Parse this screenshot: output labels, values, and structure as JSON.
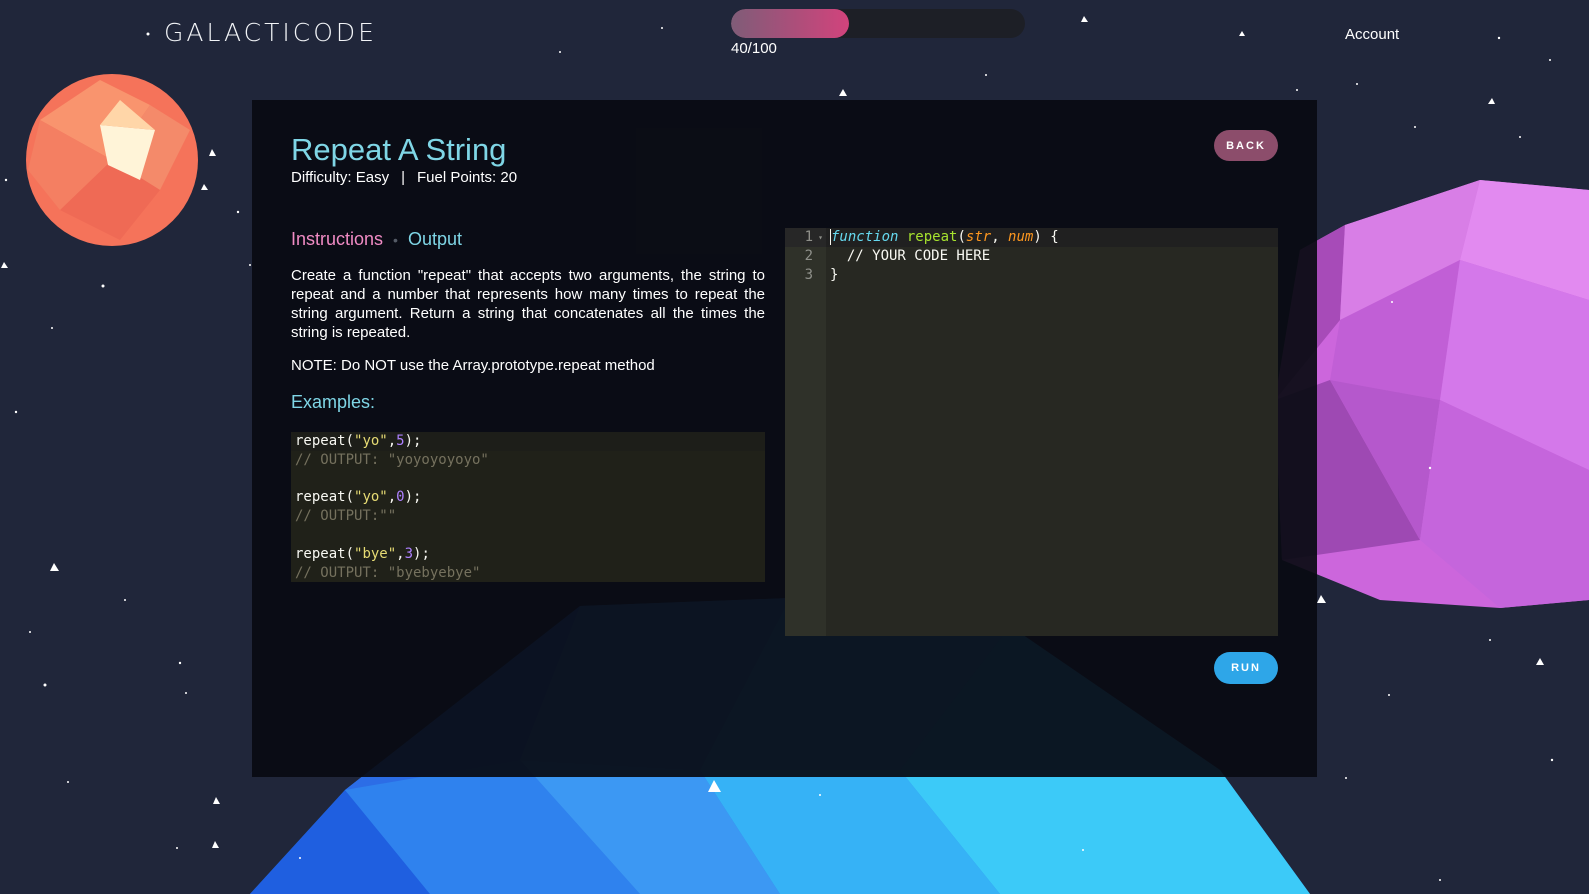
{
  "header": {
    "logo": "GALACTICODE",
    "progress": {
      "current": 40,
      "max": 100,
      "label": "40/100"
    },
    "account_label": "Account"
  },
  "challenge": {
    "title": "Repeat A String",
    "difficulty": "Difficulty: Easy",
    "separator": "|",
    "fuel_points": "Fuel Points: 20",
    "back_label": "BACK",
    "tabs": {
      "instructions": "Instructions",
      "output": "Output"
    },
    "instructions_text": "Create a function \"repeat\" that accepts two arguments, the string to repeat and a number that represents how many times to repeat the string argument. Return a string that concatenates all the times the string is repeated.",
    "note": "NOTE: Do NOT use the Array.prototype.repeat method",
    "examples_heading": "Examples:",
    "examples": [
      {
        "call_pre": "repeat(",
        "arg_str": "\"yo\"",
        "comma": ",",
        "arg_num": "5",
        "call_post": ");",
        "output": "// OUTPUT: \"yoyoyoyoyo\""
      },
      {
        "call_pre": "repeat(",
        "arg_str": "\"yo\"",
        "comma": ",",
        "arg_num": "0",
        "call_post": ");",
        "output": "// OUTPUT:\"\""
      },
      {
        "call_pre": "repeat(",
        "arg_str": "\"bye\"",
        "comma": ",",
        "arg_num": "3",
        "call_post": ");",
        "output": "// OUTPUT: \"byebyebye\""
      }
    ],
    "run_label": "RUN"
  },
  "editor": {
    "line_numbers": [
      "1",
      "2",
      "3"
    ],
    "line1": {
      "keyword": "function",
      "name": "repeat",
      "open": "(",
      "p1": "str",
      "comma": ", ",
      "p2": "num",
      "close": ") {"
    },
    "line2": "  // YOUR CODE HERE",
    "line3": "}"
  },
  "colors": {
    "background": "#20263a",
    "title": "#7fd6e6",
    "instructions_tab": "#f08bc4",
    "back_button": "#8c4d6b",
    "run_button": "#2ea6e8",
    "progress_fill": "#d2437c"
  }
}
